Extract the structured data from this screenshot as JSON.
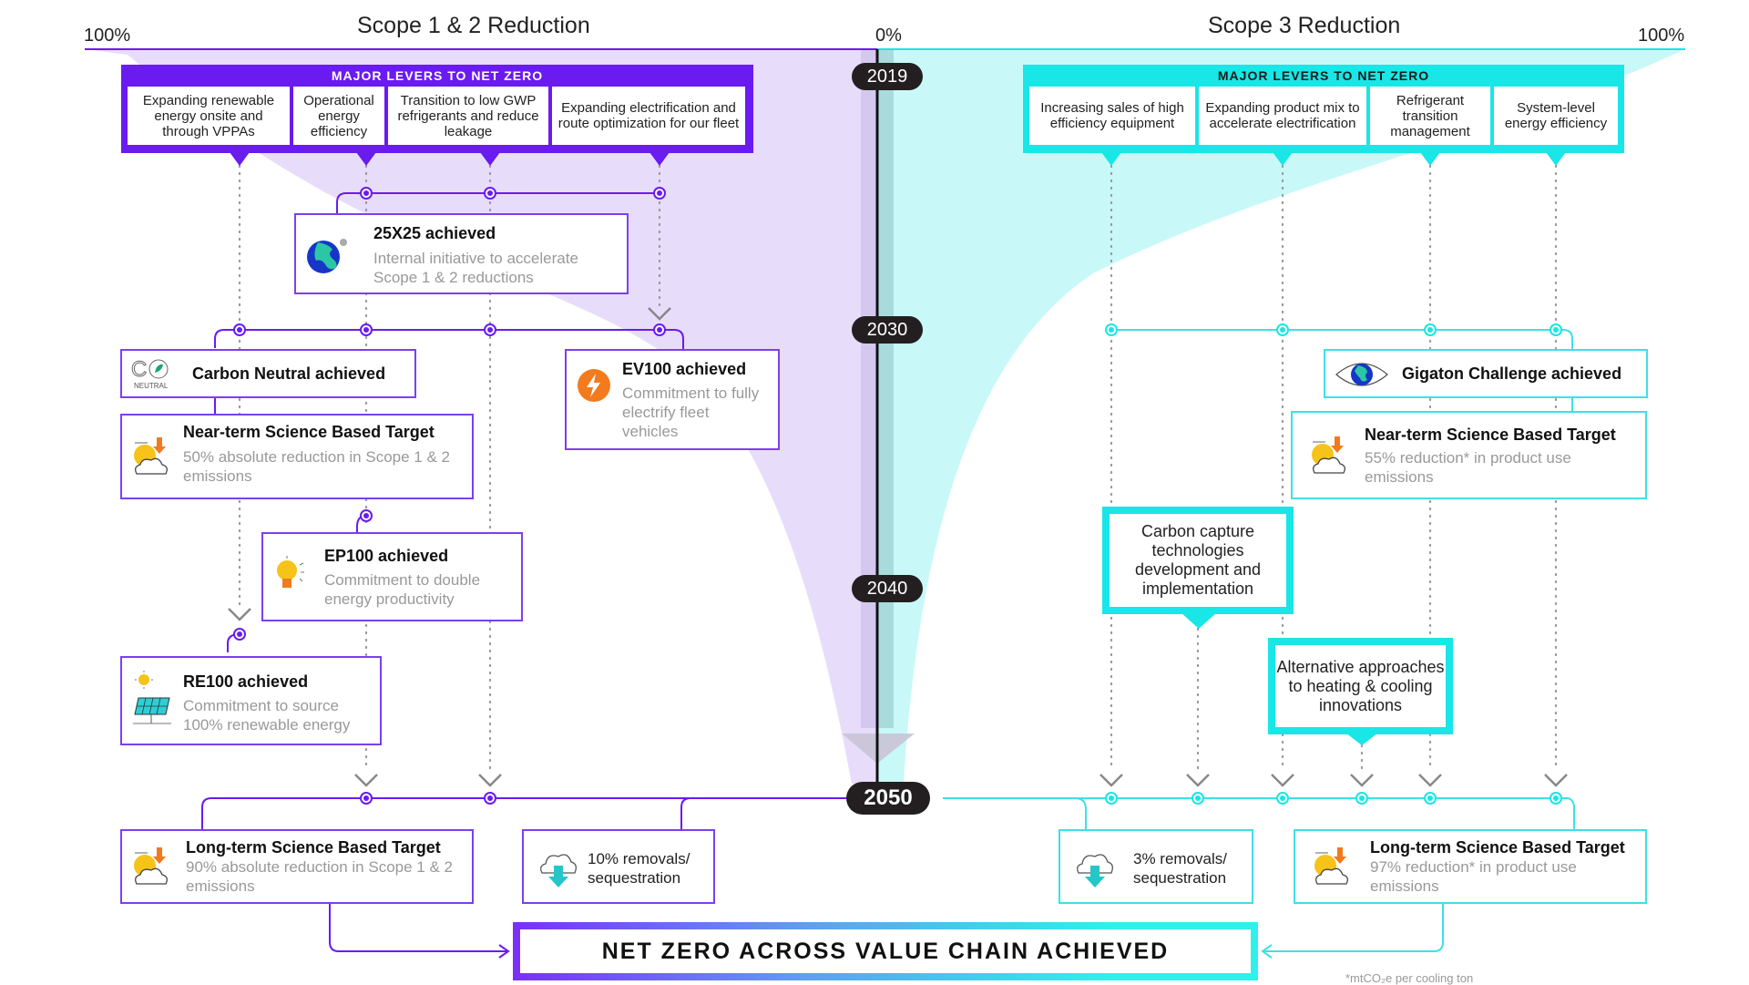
{
  "header": {
    "left_title": "Scope 1 & 2 Reduction",
    "right_title": "Scope 3 Reduction",
    "left_pct": "100%",
    "center_pct": "0%",
    "right_pct": "100%"
  },
  "timeline": {
    "years": [
      "2019",
      "2030",
      "2040",
      "2050"
    ]
  },
  "colors": {
    "scope12": "#6a1bf0",
    "scope3": "#19e6e6",
    "scope12_fill": "#e8dcfb",
    "scope3_fill": "#c8f9f8",
    "timeline_pill": "#231f20"
  },
  "scope12": {
    "levers_header": "MAJOR LEVERS TO NET ZERO",
    "levers": [
      "Expanding renewable energy onsite and through VPPAs",
      "Operational energy efficiency",
      "Transition to low GWP refrigerants and reduce leakage",
      "Expanding electrification and route optimization for our fleet"
    ],
    "milestones": {
      "m25x25": {
        "icon": "globe-icon",
        "title": "25X25 achieved",
        "desc": "Internal initiative to accelerate Scope 1 & 2 reductions"
      },
      "carbon_neutral": {
        "icon": "co2-neutral-icon",
        "title": "Carbon Neutral achieved",
        "icon_label": "NEUTRAL"
      },
      "ev100": {
        "icon": "lightning-icon",
        "title": "EV100 achieved",
        "desc": "Commitment to fully electrify fleet vehicles"
      },
      "near_sbt": {
        "icon": "sun-cloud-down-arrow-icon",
        "title": "Near-term Science Based Target",
        "desc": "50% absolute reduction in Scope 1 & 2 emissions"
      },
      "ep100": {
        "icon": "lightbulb-icon",
        "title": "EP100 achieved",
        "desc": "Commitment to double energy productivity"
      },
      "re100": {
        "icon": "solar-panel-icon",
        "title": "RE100 achieved",
        "desc": "Commitment to source 100% renewable energy"
      },
      "long_sbt": {
        "icon": "sun-cloud-down-arrow-icon",
        "title": "Long-term Science Based Target",
        "desc": "90% absolute reduction in Scope 1 & 2 emissions"
      },
      "removals": {
        "icon": "cloud-download-icon",
        "text": "10% removals/ sequestration"
      }
    }
  },
  "scope3": {
    "levers_header": "MAJOR LEVERS TO NET ZERO",
    "levers": [
      "Increasing sales of high efficiency equipment",
      "Expanding product mix to accelerate electrification",
      "Refrigerant transition management",
      "System-level energy efficiency"
    ],
    "milestones": {
      "gigaton": {
        "icon": "eye-globe-icon",
        "title": "Gigaton Challenge achieved"
      },
      "near_sbt": {
        "icon": "sun-cloud-down-arrow-icon",
        "title": "Near-term Science Based Target",
        "desc": "55% reduction* in product use emissions"
      },
      "long_sbt": {
        "icon": "sun-cloud-down-arrow-icon",
        "title": "Long-term Science Based Target",
        "desc": "97% reduction* in product use emissions"
      },
      "removals": {
        "icon": "cloud-download-icon",
        "text": "3% removals/ sequestration"
      }
    },
    "callouts": [
      "Carbon capture technologies development and implementation",
      "Alternative approaches to heating & cooling innovations"
    ]
  },
  "net_zero": "NET ZERO ACROSS VALUE CHAIN ACHIEVED",
  "footnote": "*mtCO₂e per cooling ton"
}
